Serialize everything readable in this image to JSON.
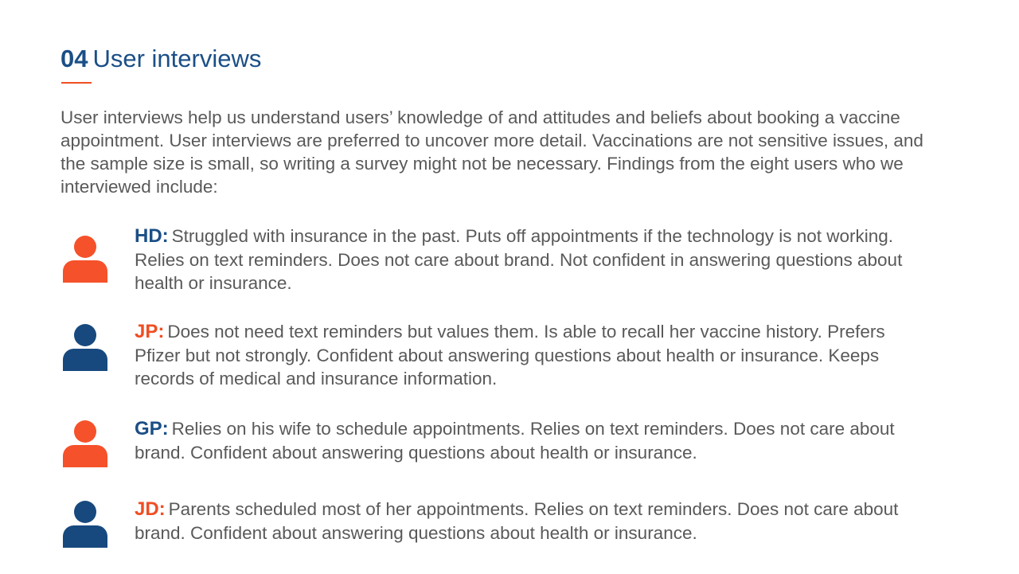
{
  "slide": {
    "number": "04",
    "title": "User interviews",
    "intro": "User interviews help us understand users’ knowledge of and attitudes and beliefs about booking a vaccine appointment. User interviews are preferred to uncover more detail. Vaccinations are not sensitive issues, and the sample size is small, so writing a survey might not be necessary. Findings from the eight users who we interviewed include:"
  },
  "colors": {
    "navy": "#1b4f86",
    "orange": "#f04e23",
    "body_text": "#595959"
  },
  "personas": [
    {
      "code": "HD:",
      "color": "orange",
      "avatar_color": "#f5512a",
      "code_color": "#1b4f86",
      "icon": "person-icon",
      "text": "Struggled with insurance in the past. Puts off appointments if the technology is not working. Relies on text reminders. Does not care about brand. Not confident in answering questions about health or insurance."
    },
    {
      "code": "JP:",
      "color": "navy",
      "avatar_color": "#17497e",
      "code_color": "#f04e23",
      "icon": "person-icon",
      "text": "Does not need text reminders but values them. Is able to recall her vaccine history. Prefers Pfizer but not strongly. Confident about answering questions about health or insurance. Keeps records of medical and insurance information."
    },
    {
      "code": "GP:",
      "color": "orange",
      "avatar_color": "#f5512a",
      "code_color": "#1b4f86",
      "icon": "person-icon",
      "text": "Relies on his wife to schedule appointments. Relies on text reminders. Does not care about brand. Confident about answering questions about health or insurance."
    },
    {
      "code": "JD:",
      "color": "navy",
      "avatar_color": "#17497e",
      "code_color": "#f04e23",
      "icon": "person-icon",
      "text": "Parents scheduled most of her appointments. Relies on text reminders. Does not care about brand. Confident about answering questions about health or insurance."
    }
  ]
}
